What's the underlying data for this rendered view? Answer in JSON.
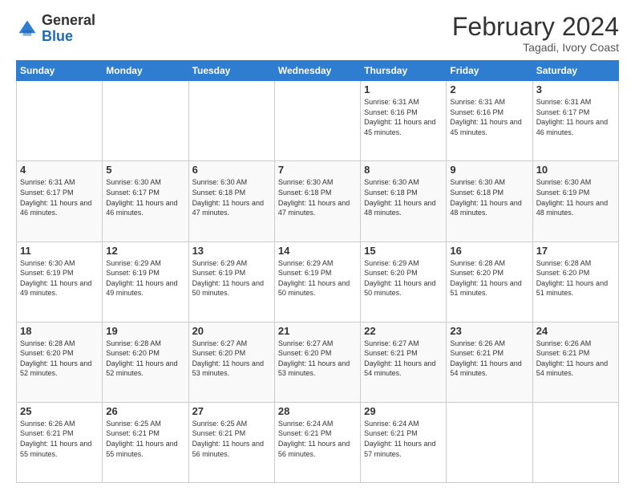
{
  "header": {
    "logo_general": "General",
    "logo_blue": "Blue",
    "month_title": "February 2024",
    "location": "Tagadi, Ivory Coast"
  },
  "days_of_week": [
    "Sunday",
    "Monday",
    "Tuesday",
    "Wednesday",
    "Thursday",
    "Friday",
    "Saturday"
  ],
  "weeks": [
    [
      {
        "day": "",
        "info": ""
      },
      {
        "day": "",
        "info": ""
      },
      {
        "day": "",
        "info": ""
      },
      {
        "day": "",
        "info": ""
      },
      {
        "day": "1",
        "info": "Sunrise: 6:31 AM\nSunset: 6:16 PM\nDaylight: 11 hours and 45 minutes."
      },
      {
        "day": "2",
        "info": "Sunrise: 6:31 AM\nSunset: 6:16 PM\nDaylight: 11 hours and 45 minutes."
      },
      {
        "day": "3",
        "info": "Sunrise: 6:31 AM\nSunset: 6:17 PM\nDaylight: 11 hours and 46 minutes."
      }
    ],
    [
      {
        "day": "4",
        "info": "Sunrise: 6:31 AM\nSunset: 6:17 PM\nDaylight: 11 hours and 46 minutes."
      },
      {
        "day": "5",
        "info": "Sunrise: 6:30 AM\nSunset: 6:17 PM\nDaylight: 11 hours and 46 minutes."
      },
      {
        "day": "6",
        "info": "Sunrise: 6:30 AM\nSunset: 6:18 PM\nDaylight: 11 hours and 47 minutes."
      },
      {
        "day": "7",
        "info": "Sunrise: 6:30 AM\nSunset: 6:18 PM\nDaylight: 11 hours and 47 minutes."
      },
      {
        "day": "8",
        "info": "Sunrise: 6:30 AM\nSunset: 6:18 PM\nDaylight: 11 hours and 48 minutes."
      },
      {
        "day": "9",
        "info": "Sunrise: 6:30 AM\nSunset: 6:18 PM\nDaylight: 11 hours and 48 minutes."
      },
      {
        "day": "10",
        "info": "Sunrise: 6:30 AM\nSunset: 6:19 PM\nDaylight: 11 hours and 48 minutes."
      }
    ],
    [
      {
        "day": "11",
        "info": "Sunrise: 6:30 AM\nSunset: 6:19 PM\nDaylight: 11 hours and 49 minutes."
      },
      {
        "day": "12",
        "info": "Sunrise: 6:29 AM\nSunset: 6:19 PM\nDaylight: 11 hours and 49 minutes."
      },
      {
        "day": "13",
        "info": "Sunrise: 6:29 AM\nSunset: 6:19 PM\nDaylight: 11 hours and 50 minutes."
      },
      {
        "day": "14",
        "info": "Sunrise: 6:29 AM\nSunset: 6:19 PM\nDaylight: 11 hours and 50 minutes."
      },
      {
        "day": "15",
        "info": "Sunrise: 6:29 AM\nSunset: 6:20 PM\nDaylight: 11 hours and 50 minutes."
      },
      {
        "day": "16",
        "info": "Sunrise: 6:28 AM\nSunset: 6:20 PM\nDaylight: 11 hours and 51 minutes."
      },
      {
        "day": "17",
        "info": "Sunrise: 6:28 AM\nSunset: 6:20 PM\nDaylight: 11 hours and 51 minutes."
      }
    ],
    [
      {
        "day": "18",
        "info": "Sunrise: 6:28 AM\nSunset: 6:20 PM\nDaylight: 11 hours and 52 minutes."
      },
      {
        "day": "19",
        "info": "Sunrise: 6:28 AM\nSunset: 6:20 PM\nDaylight: 11 hours and 52 minutes."
      },
      {
        "day": "20",
        "info": "Sunrise: 6:27 AM\nSunset: 6:20 PM\nDaylight: 11 hours and 53 minutes."
      },
      {
        "day": "21",
        "info": "Sunrise: 6:27 AM\nSunset: 6:20 PM\nDaylight: 11 hours and 53 minutes."
      },
      {
        "day": "22",
        "info": "Sunrise: 6:27 AM\nSunset: 6:21 PM\nDaylight: 11 hours and 54 minutes."
      },
      {
        "day": "23",
        "info": "Sunrise: 6:26 AM\nSunset: 6:21 PM\nDaylight: 11 hours and 54 minutes."
      },
      {
        "day": "24",
        "info": "Sunrise: 6:26 AM\nSunset: 6:21 PM\nDaylight: 11 hours and 54 minutes."
      }
    ],
    [
      {
        "day": "25",
        "info": "Sunrise: 6:26 AM\nSunset: 6:21 PM\nDaylight: 11 hours and 55 minutes."
      },
      {
        "day": "26",
        "info": "Sunrise: 6:25 AM\nSunset: 6:21 PM\nDaylight: 11 hours and 55 minutes."
      },
      {
        "day": "27",
        "info": "Sunrise: 6:25 AM\nSunset: 6:21 PM\nDaylight: 11 hours and 56 minutes."
      },
      {
        "day": "28",
        "info": "Sunrise: 6:24 AM\nSunset: 6:21 PM\nDaylight: 11 hours and 56 minutes."
      },
      {
        "day": "29",
        "info": "Sunrise: 6:24 AM\nSunset: 6:21 PM\nDaylight: 11 hours and 57 minutes."
      },
      {
        "day": "",
        "info": ""
      },
      {
        "day": "",
        "info": ""
      }
    ]
  ]
}
